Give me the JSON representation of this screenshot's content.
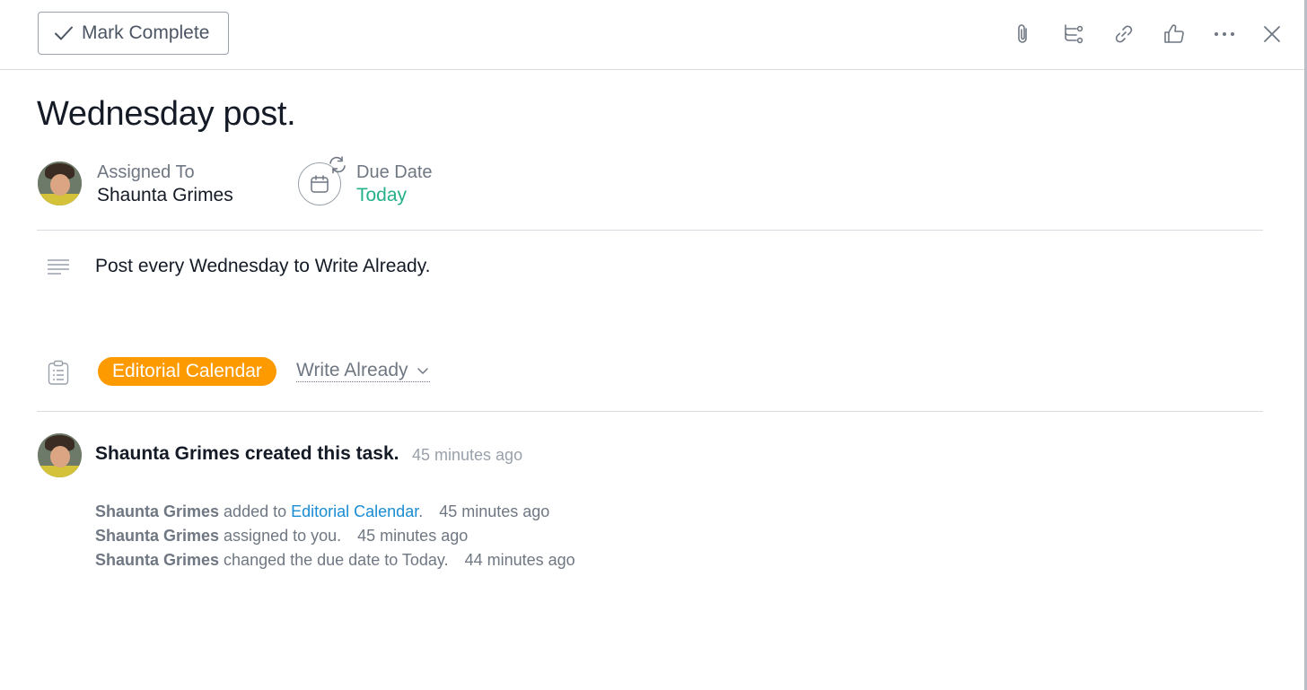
{
  "toolbar": {
    "mark_complete_label": "Mark Complete"
  },
  "task": {
    "title": "Wednesday post.",
    "assigned_label": "Assigned To",
    "assignee": "Shaunta Grimes",
    "due_label": "Due Date",
    "due_value": "Today",
    "description": "Post every Wednesday to Write Already.",
    "project": "Editorial Calendar",
    "section": "Write Already"
  },
  "activity": {
    "main": {
      "text": "Shaunta Grimes created this task.",
      "time": "45 minutes ago"
    },
    "stories": [
      {
        "who": "Shaunta Grimes",
        "action": " added to ",
        "link": "Editorial Calendar",
        "suffix": ".",
        "time": "45 minutes ago"
      },
      {
        "who": "Shaunta Grimes",
        "action": " assigned to you.",
        "time": "45 minutes ago"
      },
      {
        "who": "Shaunta Grimes",
        "action": " changed the due date to Today.",
        "time": "44 minutes ago"
      }
    ]
  },
  "colors": {
    "due_today": "#25b08a",
    "project_pill": "#fd9a00",
    "link": "#1a8dd3"
  }
}
